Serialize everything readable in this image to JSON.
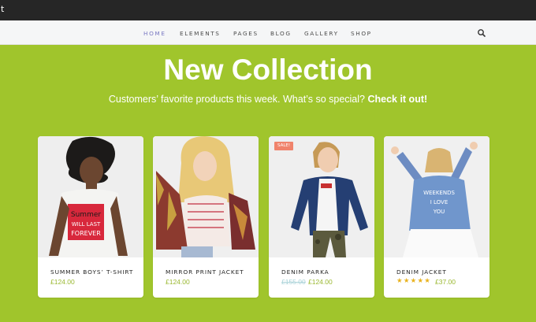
{
  "topbar": {
    "corner_char": "t"
  },
  "nav": {
    "items": [
      "HOME",
      "ELEMENTS",
      "PAGES",
      "BLOG",
      "GALLERY",
      "SHOP"
    ],
    "active": "HOME",
    "search_icon": "search-icon"
  },
  "hero": {
    "title": "New Collection",
    "subtitle": "Customers’ favorite products this week. What’s so special? ",
    "cta": "Check it out!"
  },
  "products": [
    {
      "name": "SUMMER BOYS’ T-SHIRT",
      "price": "£124.00"
    },
    {
      "name": "MIRROR PRINT JACKET",
      "price": "£124.00"
    },
    {
      "name": "DENIM PARKA",
      "old_price": "£155.00",
      "price": "£124.00",
      "badge": "SALE!"
    },
    {
      "name": "DENIM JACKET",
      "price": "£37.00",
      "rating": "★★★★★"
    }
  ],
  "colors": {
    "background": "#a0c52c",
    "nav_active": "#7a79c2",
    "price": "#9ab830",
    "old_price": "#a9d2d8",
    "sale_badge": "#f0836b",
    "stars": "#e9b21d"
  }
}
